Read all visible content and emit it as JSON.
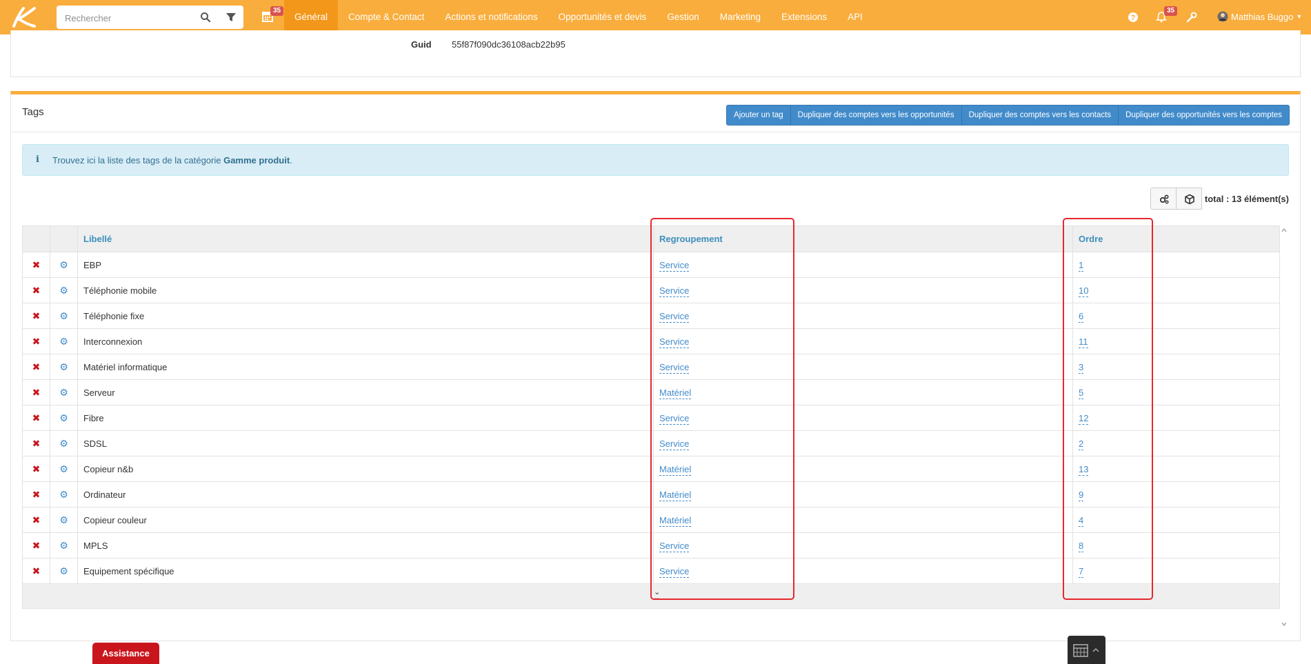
{
  "navbar": {
    "search_placeholder": "Rechercher",
    "calendar_badge": "35",
    "items": [
      {
        "label": "Général",
        "active": true
      },
      {
        "label": "Compte & Contact",
        "active": false
      },
      {
        "label": "Actions et notifications",
        "active": false
      },
      {
        "label": "Opportunités et devis",
        "active": false
      },
      {
        "label": "Gestion",
        "active": false
      },
      {
        "label": "Marketing",
        "active": false
      },
      {
        "label": "Extensions",
        "active": false
      },
      {
        "label": "API",
        "active": false
      }
    ],
    "notif_badge": "35",
    "user_name": "Matthias Buggo",
    "accent_color": "#f9ad3c"
  },
  "top_panel": {
    "guid_label": "Guid",
    "guid_value": "55f87f090dc36108acb22b95"
  },
  "tags_panel": {
    "title": "Tags",
    "buttons": [
      "Ajouter un tag",
      "Dupliquer des comptes vers les opportunités",
      "Dupliquer des comptes vers les contacts",
      "Dupliquer des opportunités vers les comptes"
    ],
    "alert_prefix": "Trouvez ici la liste des tags de la catégorie ",
    "alert_category": "Gamme produit",
    "alert_suffix": ".",
    "total": "total : 13 élément(s)"
  },
  "table": {
    "columns": [
      "Libellé",
      "Regroupement",
      "Ordre"
    ],
    "rows": [
      {
        "libelle": "EBP",
        "regroupement": "Service",
        "ordre": "1"
      },
      {
        "libelle": "Téléphonie mobile",
        "regroupement": "Service",
        "ordre": "10"
      },
      {
        "libelle": "Téléphonie fixe",
        "regroupement": "Service",
        "ordre": "6"
      },
      {
        "libelle": "Interconnexion",
        "regroupement": "Service",
        "ordre": "11"
      },
      {
        "libelle": "Matériel informatique",
        "regroupement": "Service",
        "ordre": "3"
      },
      {
        "libelle": "Serveur",
        "regroupement": "Matériel",
        "ordre": "5"
      },
      {
        "libelle": "Fibre",
        "regroupement": "Service",
        "ordre": "12"
      },
      {
        "libelle": "SDSL",
        "regroupement": "Service",
        "ordre": "2"
      },
      {
        "libelle": "Copieur n&b",
        "regroupement": "Matériel",
        "ordre": "13"
      },
      {
        "libelle": "Ordinateur",
        "regroupement": "Matériel",
        "ordre": "9"
      },
      {
        "libelle": "Copieur couleur",
        "regroupement": "Matériel",
        "ordre": "4"
      },
      {
        "libelle": "MPLS",
        "regroupement": "Service",
        "ordre": "8"
      },
      {
        "libelle": "Equipement spécifique",
        "regroupement": "Service",
        "ordre": "7"
      }
    ]
  },
  "footer": {
    "assist_label": "Assistance"
  }
}
